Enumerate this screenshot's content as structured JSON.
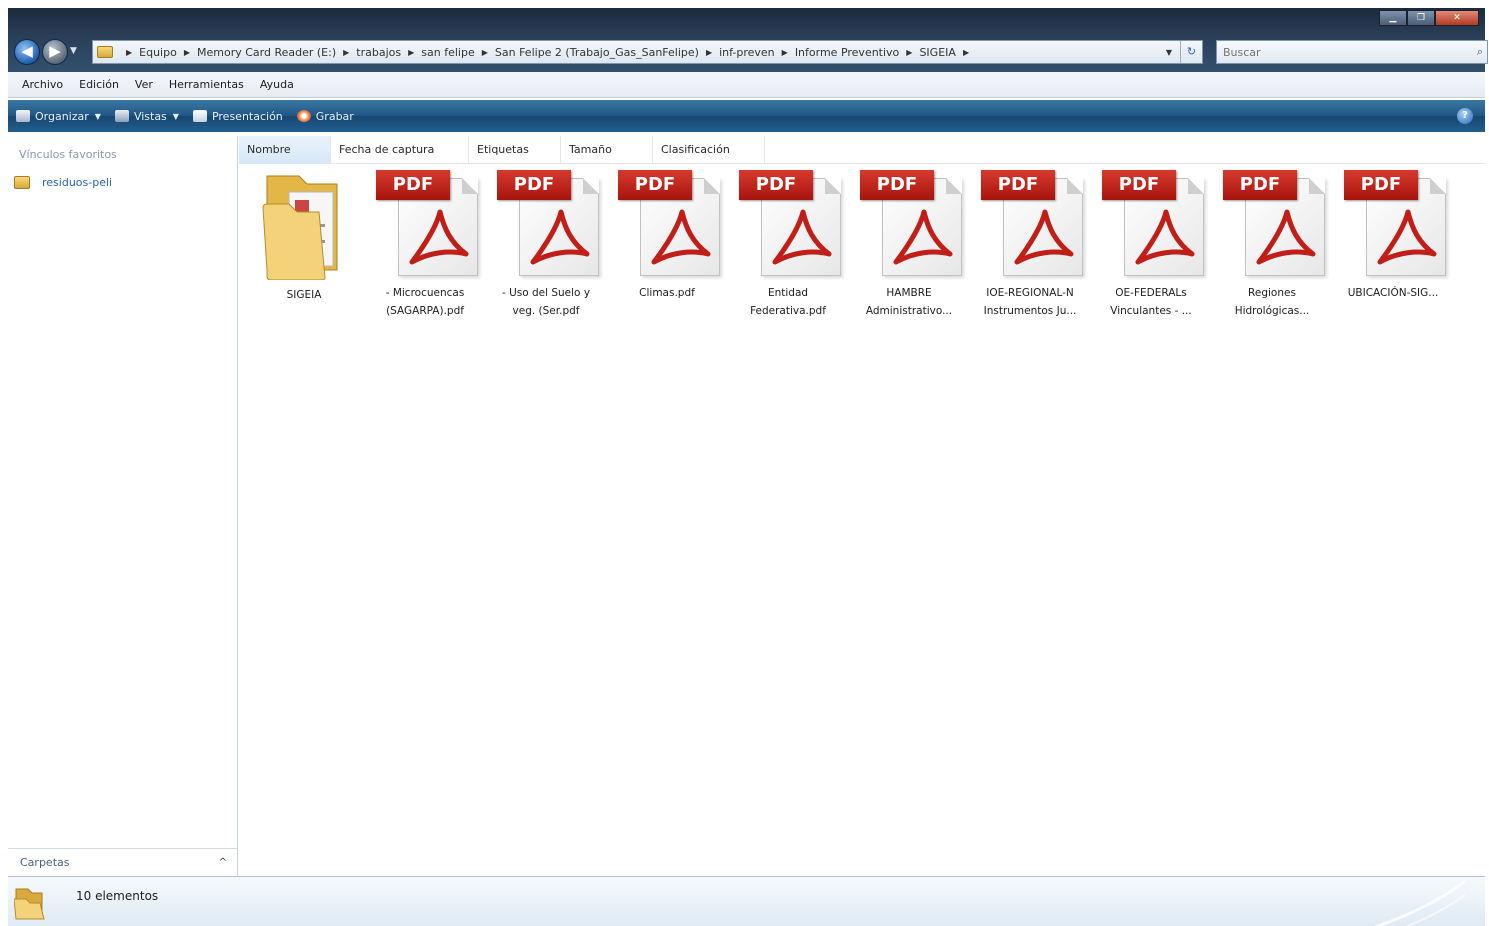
{
  "window": {
    "controls": {
      "minimize": "▁",
      "maximize": "❐",
      "close": "✕"
    }
  },
  "nav": {
    "back": "◀",
    "forward": "▶",
    "dropdown": "▼"
  },
  "address": {
    "crumbs": [
      "Equipo",
      "Memory Card Reader (E:)",
      "trabajos",
      "san felipe",
      "San Felipe 2 (Trabajo_Gas_SanFelipe)",
      "inf-preven",
      "Informe Preventivo",
      "SIGEIA"
    ],
    "dropdown": "▼",
    "refresh": "↻"
  },
  "search": {
    "placeholder": "Buscar",
    "icon": "⌕"
  },
  "menu": [
    "Archivo",
    "Edición",
    "Ver",
    "Herramientas",
    "Ayuda"
  ],
  "toolbar": {
    "organize": "Organizar",
    "views": "Vistas",
    "slideshow": "Presentación",
    "burn": "Grabar",
    "help": "?"
  },
  "sidebar": {
    "favorites_heading": "Vínculos favoritos",
    "favorites": [
      {
        "label": "residuos-peli"
      }
    ],
    "folders_label": "Carpetas",
    "folders_chevron": "^"
  },
  "columns": [
    "Nombre",
    "Fecha de captura",
    "Etiquetas",
    "Tamaño",
    "Clasificación"
  ],
  "files": [
    {
      "type": "folder",
      "label": "SIGEIA"
    },
    {
      "type": "pdf",
      "badge": "PDF",
      "label": "- Microcuencas\n(SAGARPA).pdf"
    },
    {
      "type": "pdf",
      "badge": "PDF",
      "label": "- Uso del Suelo y\nveg. (Ser.pdf"
    },
    {
      "type": "pdf",
      "badge": "PDF",
      "label": "Climas.pdf"
    },
    {
      "type": "pdf",
      "badge": "PDF",
      "label": "Entidad\nFederativa.pdf"
    },
    {
      "type": "pdf",
      "badge": "PDF",
      "label": "HAMBRE\nAdministrativo..."
    },
    {
      "type": "pdf",
      "badge": "PDF",
      "label": "IOE-REGIONAL-N\nInstrumentos Ju..."
    },
    {
      "type": "pdf",
      "badge": "PDF",
      "label": "OE-FEDERALs\nVinculantes - ..."
    },
    {
      "type": "pdf",
      "badge": "PDF",
      "label": "Regiones\nHidrológicas..."
    },
    {
      "type": "pdf",
      "badge": "PDF",
      "label": "UBICACIÓN-SIG..."
    }
  ],
  "status": {
    "count": "10 elementos"
  },
  "colors": {
    "accent": "#1f5585",
    "pdf_red": "#c11e17",
    "link": "#2a64b4"
  }
}
